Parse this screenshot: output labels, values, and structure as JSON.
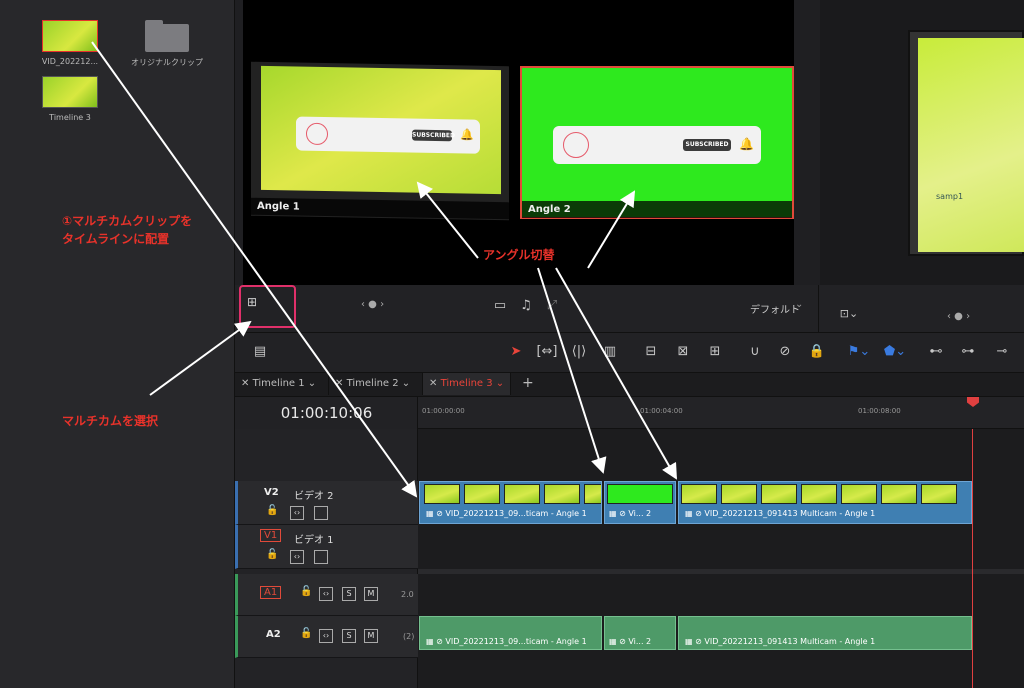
{
  "media_pool": {
    "items": [
      {
        "label": "VID_202212..."
      },
      {
        "label": "オリジナルクリップ"
      },
      {
        "label": "Timeline 3"
      }
    ]
  },
  "viewer": {
    "angle1_label": "Angle 1",
    "angle2_label": "Angle 2",
    "subscribed_text": "SUBSCRIBED",
    "nav": "‹ ● ›",
    "view_mode": "デフォルト",
    "right_overlay_text": "samp1"
  },
  "timeline": {
    "tabs": [
      "Timeline 1",
      "Timeline 2",
      "Timeline 3"
    ],
    "add_tab": "+",
    "timecode": "01:00:10:06",
    "ruler": [
      "01:00:00:00",
      "01:00:04:00",
      "01:00:08:00"
    ],
    "tracks": {
      "v2": {
        "id": "V2",
        "name": "ビデオ 2"
      },
      "v1": {
        "id": "V1",
        "name": "ビデオ 1"
      },
      "a1": {
        "id": "A1",
        "level": "2.0",
        "s": "S",
        "m": "M"
      },
      "a2": {
        "id": "A2",
        "level": "(2)",
        "s": "S",
        "m": "M"
      }
    },
    "video_clips": [
      {
        "label": "VID_20221213_09...ticam - Angle 1"
      },
      {
        "label": "Vi... 2"
      },
      {
        "label": "VID_20221213_091413 Multicam - Angle 1"
      }
    ],
    "audio_clips": [
      {
        "label": "VID_20221213_09...ticam - Angle 1"
      },
      {
        "label": "Vi... 2"
      },
      {
        "label": "VID_20221213_091413 Multicam - Angle 1"
      }
    ]
  },
  "annotations": {
    "step1_line1": "①マルチカムクリップを",
    "step1_line2": "タイムラインに配置",
    "angle_switch": "アングル切替",
    "select_multicam": "マルチカムを選択"
  },
  "colors": {
    "accent_red": "#e8322a",
    "highlight_pink": "#e0306a",
    "clip_blue": "#3f7fb2",
    "clip_green": "#4e9a68",
    "playhead": "#e04040"
  }
}
